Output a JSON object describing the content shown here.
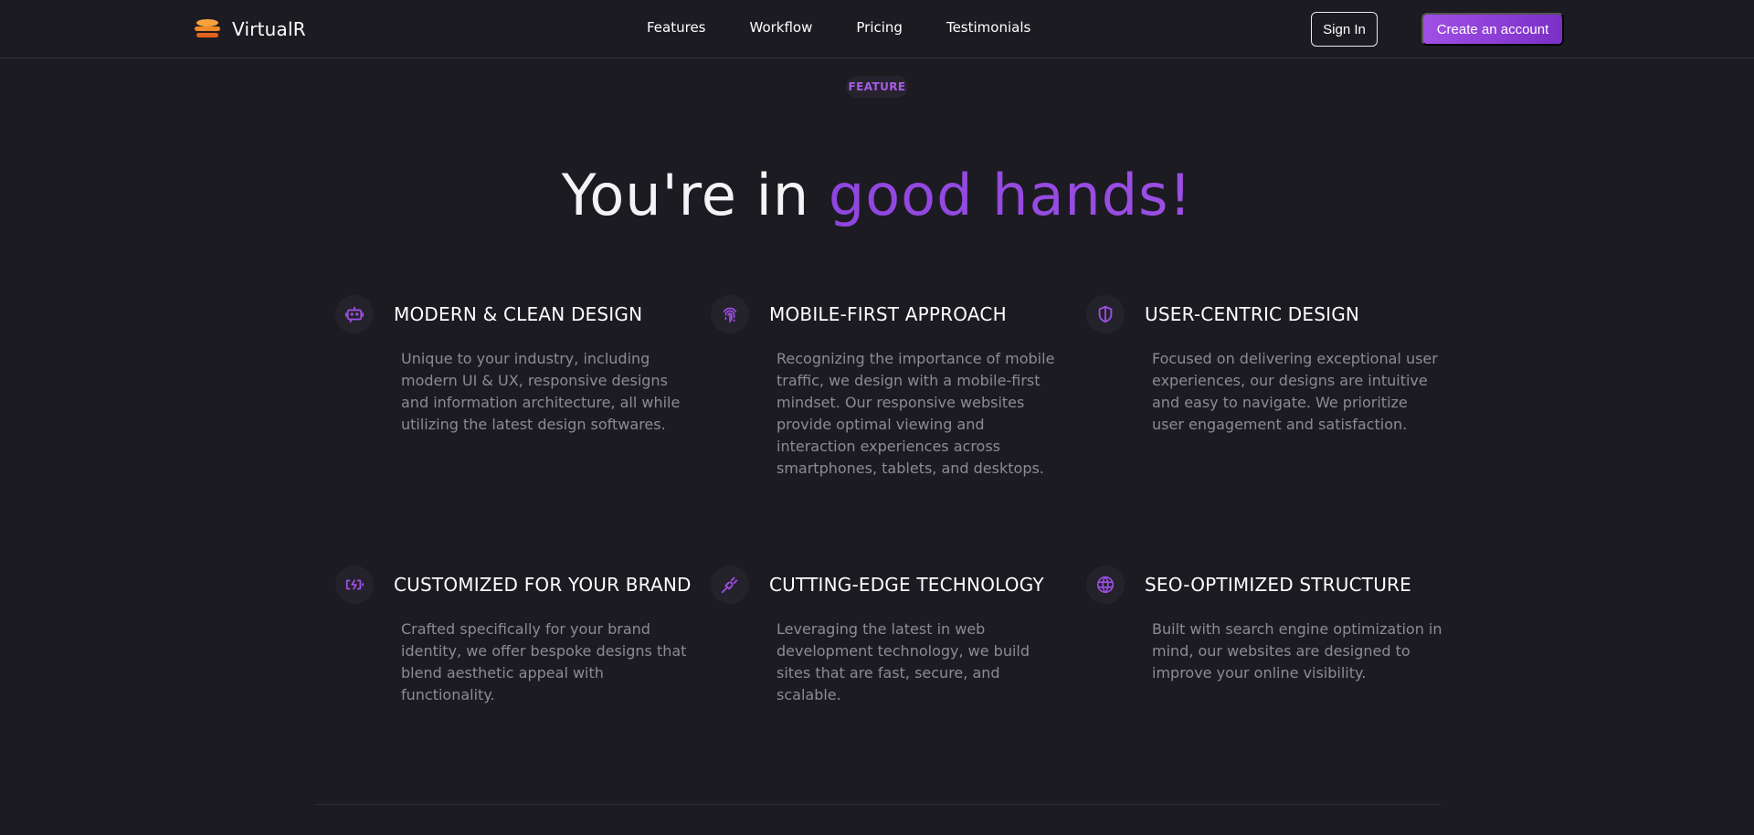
{
  "brand": {
    "name": "VirtualR",
    "logo_icon": "layered-disc-logo",
    "logo_colors": [
      "#f7a23b",
      "#ea6a1c"
    ]
  },
  "nav": {
    "links": [
      "Features",
      "Workflow",
      "Pricing",
      "Testimonials"
    ],
    "sign_in_label": "Sign In",
    "create_account_label": "Create an account"
  },
  "hero": {
    "eyebrow": "FEATURE",
    "title_plain": "You're in ",
    "title_accent": "good hands!"
  },
  "features": [
    {
      "icon": "chatbot-icon",
      "title": "MODERN & CLEAN DESIGN",
      "description": "Unique to your industry, including modern UI & UX, responsive designs and information architecture, all while utilizing the latest design softwares."
    },
    {
      "icon": "fingerprint-icon",
      "title": "MOBILE-FIRST APPROACH",
      "description": "Recognizing the importance of mobile traffic, we design with a mobile-first mindset. Our responsive websites provide optimal viewing and interaction experiences across smartphones, tablets, and desktops."
    },
    {
      "icon": "shield-icon",
      "title": "USER-CENTRIC DESIGN",
      "description": "Focused on delivering exceptional user experiences, our designs are intuitive and easy to navigate. We prioritize user engagement and satisfaction."
    },
    {
      "icon": "battery-charging-icon",
      "title": "CUSTOMIZED FOR YOUR BRAND",
      "description": "Crafted specifically for your brand identity, we offer bespoke designs that blend aesthetic appeal with functionality."
    },
    {
      "icon": "plug-icon",
      "title": "CUTTING-EDGE TECHNOLOGY",
      "description": "Leveraging the latest in web development technology, we build sites that are fast, secure, and scalable."
    },
    {
      "icon": "globe-icon",
      "title": "SEO-OPTIMIZED STRUCTURE",
      "description": "Built with search engine optimization in mind, our websites are designed to improve your online visibility."
    }
  ],
  "colors": {
    "accent": "#9b4fe2",
    "background": "#1c1b22",
    "muted_text": "#8c8b93"
  }
}
